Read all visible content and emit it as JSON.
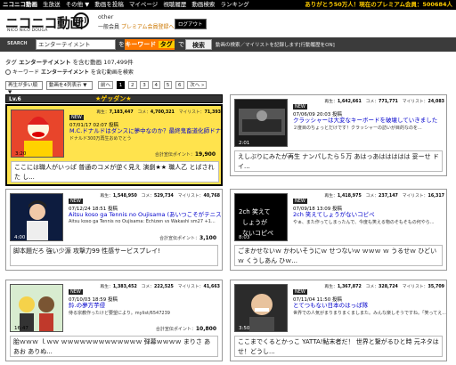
{
  "topbar": {
    "brand": "ニコニコ動画",
    "links": [
      "ニコニコ動画",
      "生放送",
      "その他 ▼",
      "動画を投稿",
      "マイページ",
      "視聴履歴",
      "動画検索",
      "ランキング"
    ],
    "promo": "ありがとう50万人！現在のプレミアム会員：500684人"
  },
  "header": {
    "logo": "ニコニコ動画",
    "logo_sub": "NICO NICO DOUGA",
    "logo_badge": "(β)",
    "user_name": "other",
    "user_status": "一般会員",
    "premium_link": "プレミアム会員登録へ",
    "logout": "ログアウト"
  },
  "search": {
    "label": "SEARCH",
    "query": "エンターテイメント",
    "wo": "を",
    "keyword": "キーワード",
    "tag": "タグ",
    "de": "で",
    "button": "検索",
    "note": "動画の検索／マイリストを記録します[行動履歴をON]"
  },
  "summary": {
    "prefix": "タグ",
    "tag": "エンターテイメント",
    "middle": "を含む動画",
    "count": "107,499件"
  },
  "keyword_search": {
    "label": "キーワード",
    "tag": "エンターテイメント",
    "suffix": "を含む動画を検索"
  },
  "controls": {
    "sort": "再生が多い順 ▼",
    "per_page": "動画を4列表示 ▼",
    "pages": [
      "前へ",
      "1",
      "2",
      "3",
      "4",
      "5",
      "6",
      "次へ »"
    ],
    "current_page": "1"
  },
  "category": {
    "level": "Lv.6",
    "name": "★ゲッダン★"
  },
  "cards": [
    {
      "views": "7,183,447",
      "comments": "4,700,321",
      "mylist": "71,393",
      "date": "07/01/17 02:07 投稿",
      "title": "M.C.ドナルドはダンスに夢中なのか？最終鬼畜道化師ドナルド・M",
      "desc": "ドナルド300万再生おめでとう",
      "tags": "",
      "points": "19,900",
      "duration": "3:20",
      "comment": "ここには職人がいっぱ 普通のコメが逆く見え 演劇★★ 職人乙 とばされた し..."
    },
    {
      "views": "1,642,661",
      "comments": "771,771",
      "mylist": "24,083",
      "date": "07/06/09 20:03 投稿",
      "title": "クラッシャーは大変なキーボードを破壊していきました",
      "desc": "２度目のちょっとだけです！クラッシャーの訪いが目的なのを...",
      "tags": "",
      "points": "",
      "duration": "2:01",
      "comment": "えしぶりにみたが再生 ナンパしたら５万 あはっあははははは 妥ーせ ドイ..."
    },
    {
      "views": "1,548,950",
      "comments": "529,734",
      "mylist": "40,768",
      "date": "07/12/24 18:51 投稿",
      "title": "Aitsu koso ga Tennis no Oujisama (あいつこそがテニスの王子様)",
      "desc": "Aitsu koso ga Tennis no Oujisama: Echizen vs Wakashi sm27 +1...",
      "tags": "",
      "points": "3,100",
      "duration": "4:00",
      "comment": "脚本題だろ 強い少源 攻撃力99 性感サービスプレイ!"
    },
    {
      "views": "1,418,975",
      "comments": "237,147",
      "mylist": "16,317",
      "date": "07/09/18 13:09 投稿",
      "title": "2ch 笑えてしょうがないコピペ",
      "desc": "やぁ、また作ってしまったんで、今度も笑える物のそもそもの何やら...",
      "tags": "",
      "points": "",
      "duration": "8:03",
      "comment": "ごまかせないｗ かわいそうにｗ せつないｗ ｗｗｗ ｗ うるせｗ ひどいｗ くうしあん ひｗ..."
    },
    {
      "views": "1,383,452",
      "comments": "222,525",
      "mylist": "41,663",
      "date": "07/10/03 18:59 投稿",
      "title": "鈴.の夢方芋侵",
      "desc": "侍る宗教作ったけど要望により。mylist/6547239",
      "tags": "",
      "points": "10,800",
      "duration": "16:47",
      "comment": "胎ｗｗｗ ｌｗｗ ｗｗｗｗｗｗｗｗｗｗｗｗｗ 弾幕ｗｗｗｗ まりさ ああお ありぬ..."
    },
    {
      "views": "1,367,872",
      "comments": "328,724",
      "mylist": "35,709",
      "date": "07/11/04 11:50 投稿",
      "title": "とてつもない日本のはっぱ隊",
      "desc": "世界での人気がまりまりまくましまた。みんな楽しそうですね。「笑ってえ...",
      "tags": "",
      "points": "",
      "duration": "3:50",
      "comment": "ここまでくるとかっこ YATTA!鮎末者だ！ 世界と繋がるひと時 元ネタはせ！どうし..."
    }
  ]
}
